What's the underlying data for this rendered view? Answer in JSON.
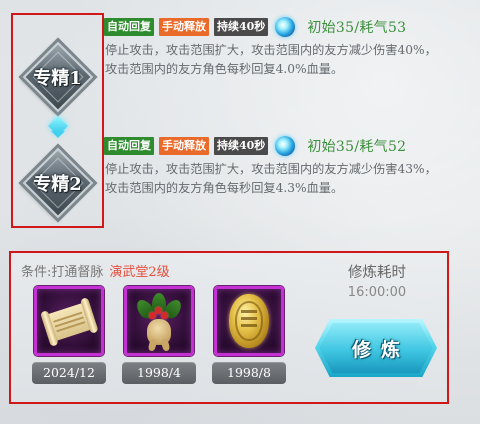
{
  "specs": {
    "spec1_label": "专精1",
    "spec2_label": "专精2"
  },
  "skills": [
    {
      "tag_auto": "自动回复",
      "tag_manual": "手动释放",
      "tag_duration": "持续40秒",
      "icon": "blue-orb-icon",
      "cost": "初始35/耗气53",
      "description": "停止攻击，攻击范围扩大，攻击范围内的友方减少伤害40%，攻击范围内的友方角色每秒回复4.0%血量。"
    },
    {
      "tag_auto": "自动回复",
      "tag_manual": "手动释放",
      "tag_duration": "持续40秒",
      "icon": "blue-orb-icon",
      "cost": "初始35/耗气52",
      "description": "停止攻击，攻击范围扩大，攻击范围内的友方减少伤害43%，攻击范围内的友方角色每秒回复4.3%血量。"
    }
  ],
  "condition": {
    "label": "条件:打通督脉",
    "highlight": "演武堂2级"
  },
  "materials": [
    {
      "icon": "scroll-icon",
      "count": "2024/12"
    },
    {
      "icon": "ginseng-icon",
      "count": "1998/4"
    },
    {
      "icon": "gold-coin-icon",
      "count": "1998/8"
    }
  ],
  "cultivate": {
    "time_title": "修炼耗时",
    "time_value": "16:00:00",
    "button_label": "修炼"
  },
  "colors": {
    "highlight_border": "#d01818",
    "cost_green": "#3c8f3c",
    "tag_green": "#2e8b2e",
    "tag_orange": "#ea6a2a",
    "tag_dark": "#4a4a4a",
    "condition_red": "#e84c3d",
    "item_frame_purple": "#c430d4",
    "button_cyan": "#3fc6e2"
  }
}
